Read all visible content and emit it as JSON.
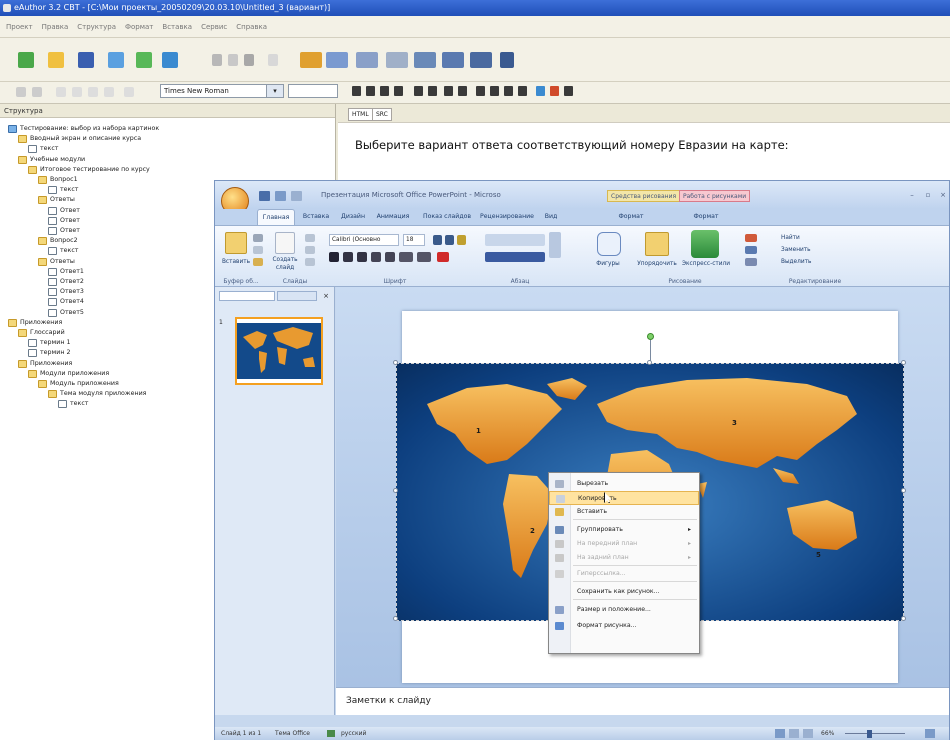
{
  "app": {
    "title": "eAuthor 3.2 CBT - [C:\\Мои проекты_20050209\\20.03.10\\Untitled_3 (вариант)]"
  },
  "menubar": [
    "Проект",
    "Правка",
    "Структура",
    "Формат",
    "Вставка",
    "Сервис",
    "Справка"
  ],
  "font": {
    "name": "Times New Roman"
  },
  "tree": {
    "header": "Структура",
    "nodes": [
      {
        "label": "Тестирование: выбор из набора картинок",
        "icon": "root"
      },
      {
        "label": "Вводный экран и описание курса",
        "icon": "folder"
      },
      {
        "label": "текст",
        "icon": "doc"
      },
      {
        "label": "Учебные модули",
        "icon": "folder"
      },
      {
        "label": "Итоговое тестирование по курсу",
        "icon": "folder"
      },
      {
        "label": "Вопрос1",
        "icon": "folder"
      },
      {
        "label": "текст",
        "icon": "doc"
      },
      {
        "label": "Ответы",
        "icon": "folder"
      },
      {
        "label": "Ответ",
        "icon": "doc"
      },
      {
        "label": "Ответ",
        "icon": "doc"
      },
      {
        "label": "Ответ",
        "icon": "doc"
      },
      {
        "label": "Вопрос2",
        "icon": "folder"
      },
      {
        "label": "текст",
        "icon": "doc"
      },
      {
        "label": "Ответы",
        "icon": "folder"
      },
      {
        "label": "Ответ1",
        "icon": "doc"
      },
      {
        "label": "Ответ2",
        "icon": "doc"
      },
      {
        "label": "Ответ3",
        "icon": "doc"
      },
      {
        "label": "Ответ4",
        "icon": "doc"
      },
      {
        "label": "Ответ5",
        "icon": "doc"
      },
      {
        "label": "Приложения",
        "icon": "folder"
      },
      {
        "label": "Глоссарий",
        "icon": "folder"
      },
      {
        "label": "термин 1",
        "icon": "doc"
      },
      {
        "label": "термин 2",
        "icon": "doc"
      },
      {
        "label": "Приложения",
        "icon": "folder"
      },
      {
        "label": "Модули приложения",
        "icon": "folder"
      },
      {
        "label": "Модуль приложения",
        "icon": "folder"
      },
      {
        "label": "Тема модуля приложения",
        "icon": "folder"
      },
      {
        "label": "текст",
        "icon": "doc"
      }
    ]
  },
  "editor": {
    "tabs": [
      "HTML",
      "SRC"
    ],
    "question": "Выберите вариант ответа соответствующий номеру Евразии на карте:"
  },
  "ppt": {
    "title": "Презентация Microsoft Office PowerPoint - Microsoft PowerPoint",
    "context_tab_1": "Средства рисования",
    "context_tab_2": "Работа с рисунками",
    "tabs": [
      "Главная",
      "Вставка",
      "Дизайн",
      "Анимация",
      "Показ слайдов",
      "Рецензирование",
      "Вид",
      "Формат",
      "Формат"
    ],
    "ribbon": {
      "paste": "Вставить",
      "new_slide": "Создать слайд",
      "font_box": "Calibri (Основно",
      "font_size": "18",
      "groups": [
        "Буфер об...",
        "Слайды",
        "Шрифт",
        "Абзац",
        "Рисование",
        "Редактирование"
      ],
      "shapes": "Фигуры",
      "arrange": "Упорядочить",
      "quick_styles": "Экспресс-стили",
      "find": "Найти",
      "replace": "Заменить",
      "select": "Выделить"
    },
    "map_labels": [
      "1",
      "2",
      "3",
      "5"
    ],
    "notes": "Заметки к слайду",
    "status": {
      "slide": "Слайд 1 из 1",
      "theme": "Тема Office",
      "lang": "русский",
      "zoom": "66%"
    }
  },
  "context_menu": [
    {
      "label": "Вырезать",
      "state": "normal"
    },
    {
      "label": "Копировать",
      "state": "highlighted"
    },
    {
      "label": "Вставить",
      "state": "normal"
    },
    {
      "label": "Группировать",
      "state": "normal",
      "submenu": true
    },
    {
      "label": "На передний план",
      "state": "disabled",
      "submenu": true
    },
    {
      "label": "На задний план",
      "state": "disabled",
      "submenu": true
    },
    {
      "label": "Гиперссылка...",
      "state": "disabled"
    },
    {
      "label": "Сохранить как рисунок...",
      "state": "normal"
    },
    {
      "label": "Размер и положение...",
      "state": "normal"
    },
    {
      "label": "Формат рисунка...",
      "state": "normal"
    }
  ]
}
